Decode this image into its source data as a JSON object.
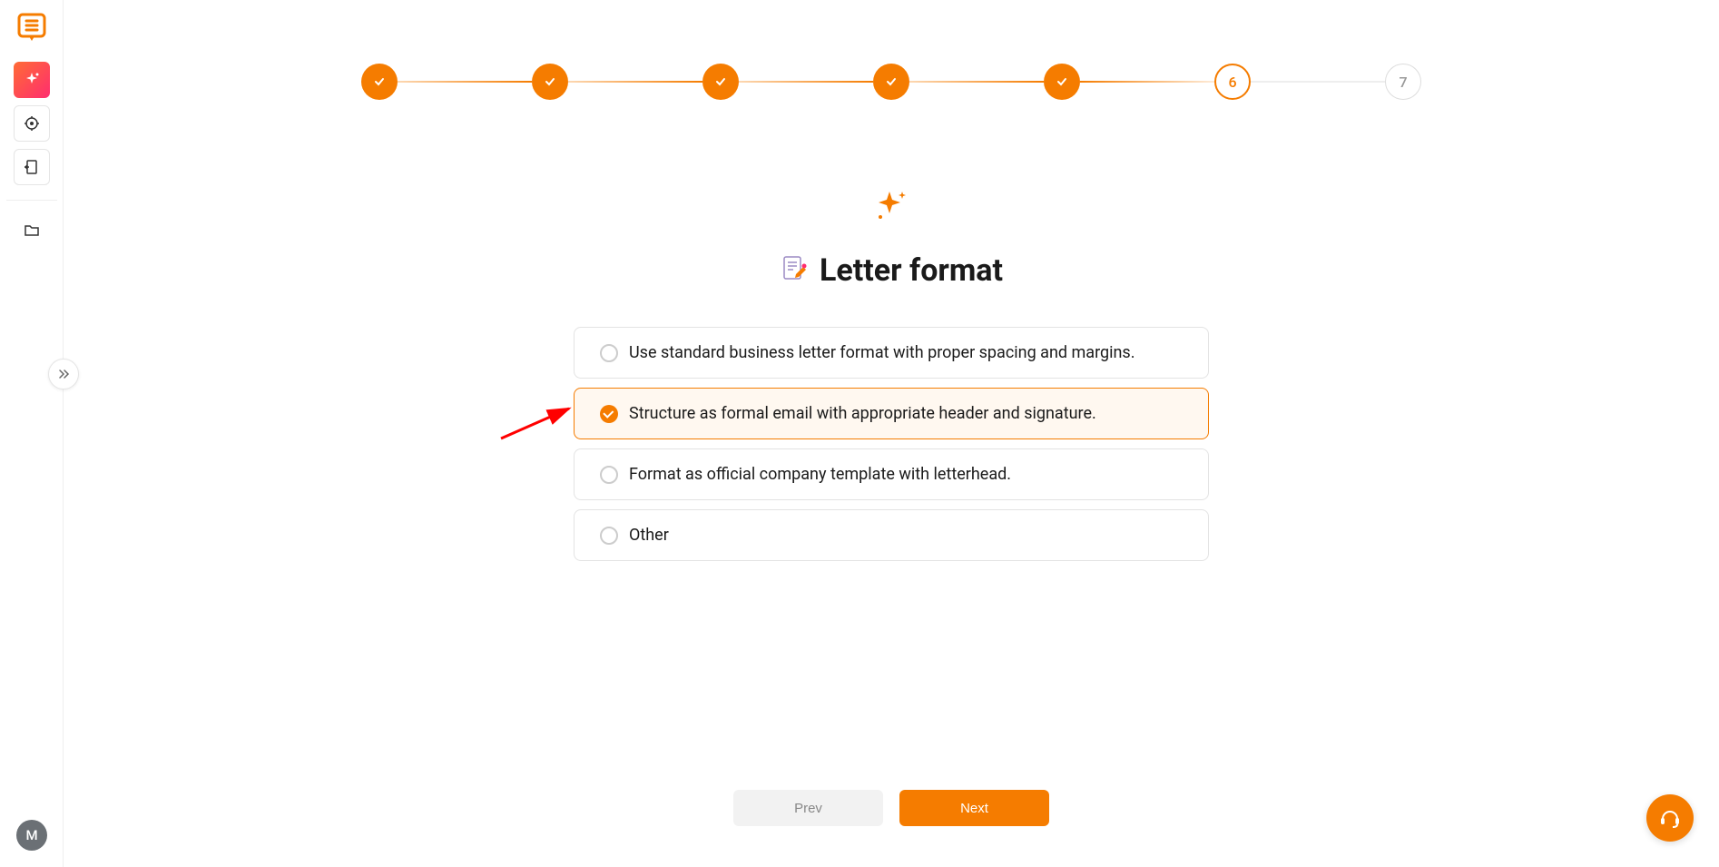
{
  "sidebar": {
    "avatar_initial": "M"
  },
  "stepper": {
    "steps": [
      {
        "state": "completed"
      },
      {
        "state": "completed"
      },
      {
        "state": "completed"
      },
      {
        "state": "completed"
      },
      {
        "state": "completed"
      },
      {
        "state": "current",
        "label": "6"
      },
      {
        "state": "pending",
        "label": "7"
      }
    ]
  },
  "page": {
    "title": "Letter format"
  },
  "options": [
    {
      "label": "Use standard business letter format with proper spacing and margins.",
      "selected": false
    },
    {
      "label": "Structure as formal email with appropriate header and signature.",
      "selected": true
    },
    {
      "label": "Format as official company template with letterhead.",
      "selected": false
    },
    {
      "label": "Other",
      "selected": false
    }
  ],
  "footer": {
    "prev_label": "Prev",
    "next_label": "Next"
  }
}
